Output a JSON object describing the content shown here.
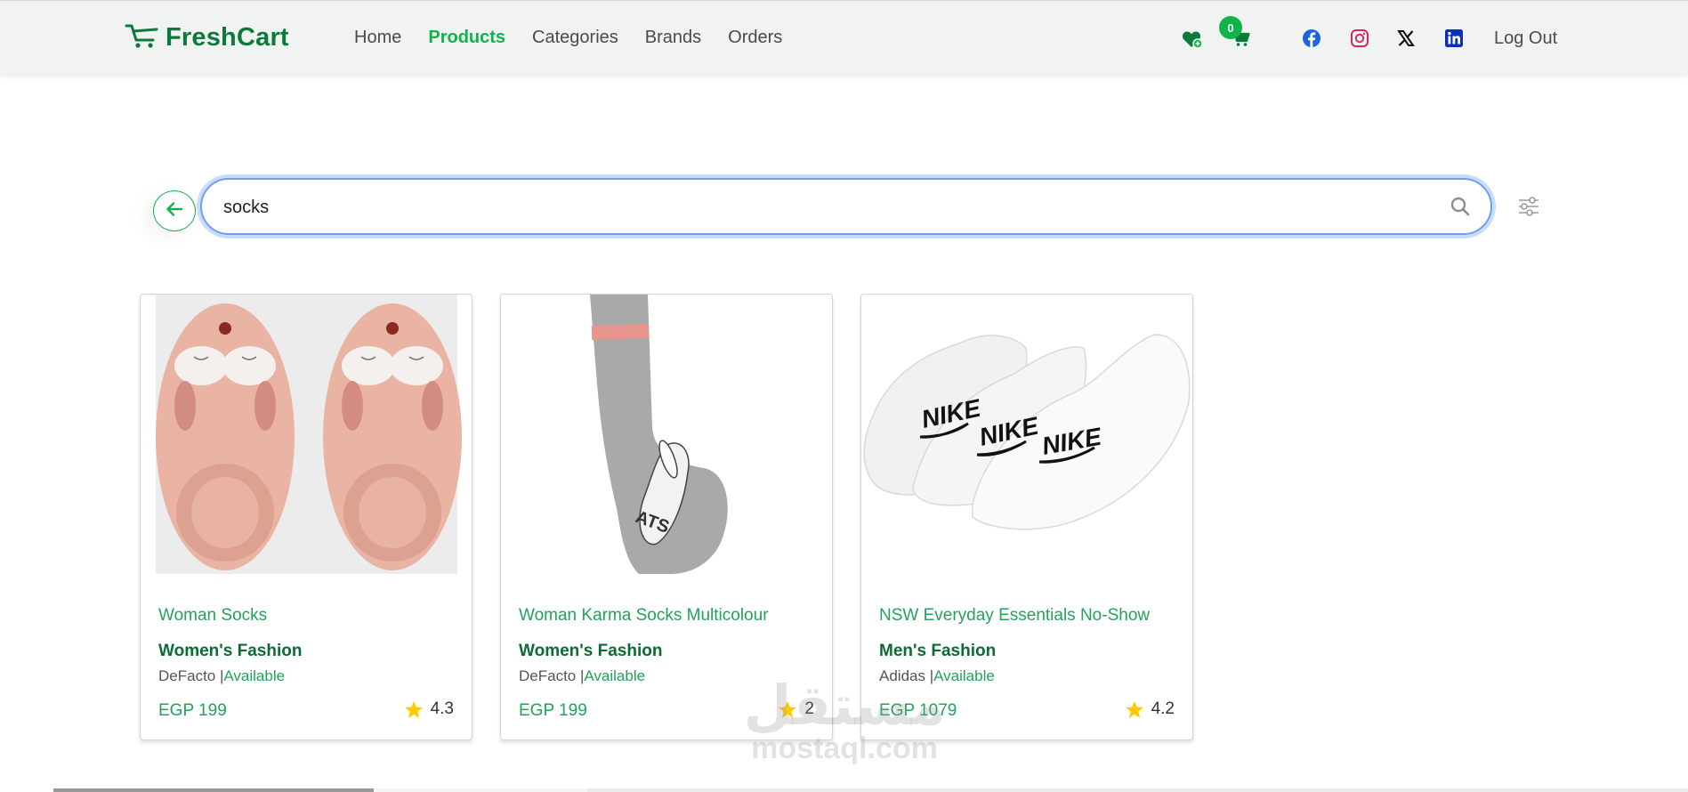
{
  "navbar": {
    "brand": "FreshCart",
    "links": [
      {
        "label": "Home"
      },
      {
        "label": "Products",
        "active": true
      },
      {
        "label": "Categories"
      },
      {
        "label": "Brands"
      },
      {
        "label": "Orders"
      }
    ],
    "cart_count": "0",
    "social": [
      "facebook-icon",
      "instagram-icon",
      "x-icon",
      "linkedin-icon"
    ],
    "logout_label": "Log Out"
  },
  "search": {
    "value": "socks"
  },
  "products": [
    {
      "title": "Woman Socks",
      "category": "Women's Fashion",
      "brand": "DeFacto |",
      "availability": "Available",
      "price": "EGP 199",
      "rating": "4.3"
    },
    {
      "title": "Woman Karma Socks Multicolour",
      "category": "Women's Fashion",
      "brand": "DeFacto |",
      "availability": "Available",
      "price": "EGP 199",
      "rating": "2"
    },
    {
      "title": "NSW Everyday Essentials No-Show",
      "category": "Men's Fashion",
      "brand": "Adidas |",
      "availability": "Available",
      "price": "EGP 1079",
      "rating": "4.2"
    }
  ],
  "watermark": {
    "arabic": "مستقل",
    "latin": "mostaql.com"
  },
  "colors": {
    "brand": "#0c7a3a",
    "accent": "#10b34a",
    "star": "#ffc908",
    "navbar_bg": "#f0f3f2",
    "search_focus": "#6d9ef0"
  }
}
